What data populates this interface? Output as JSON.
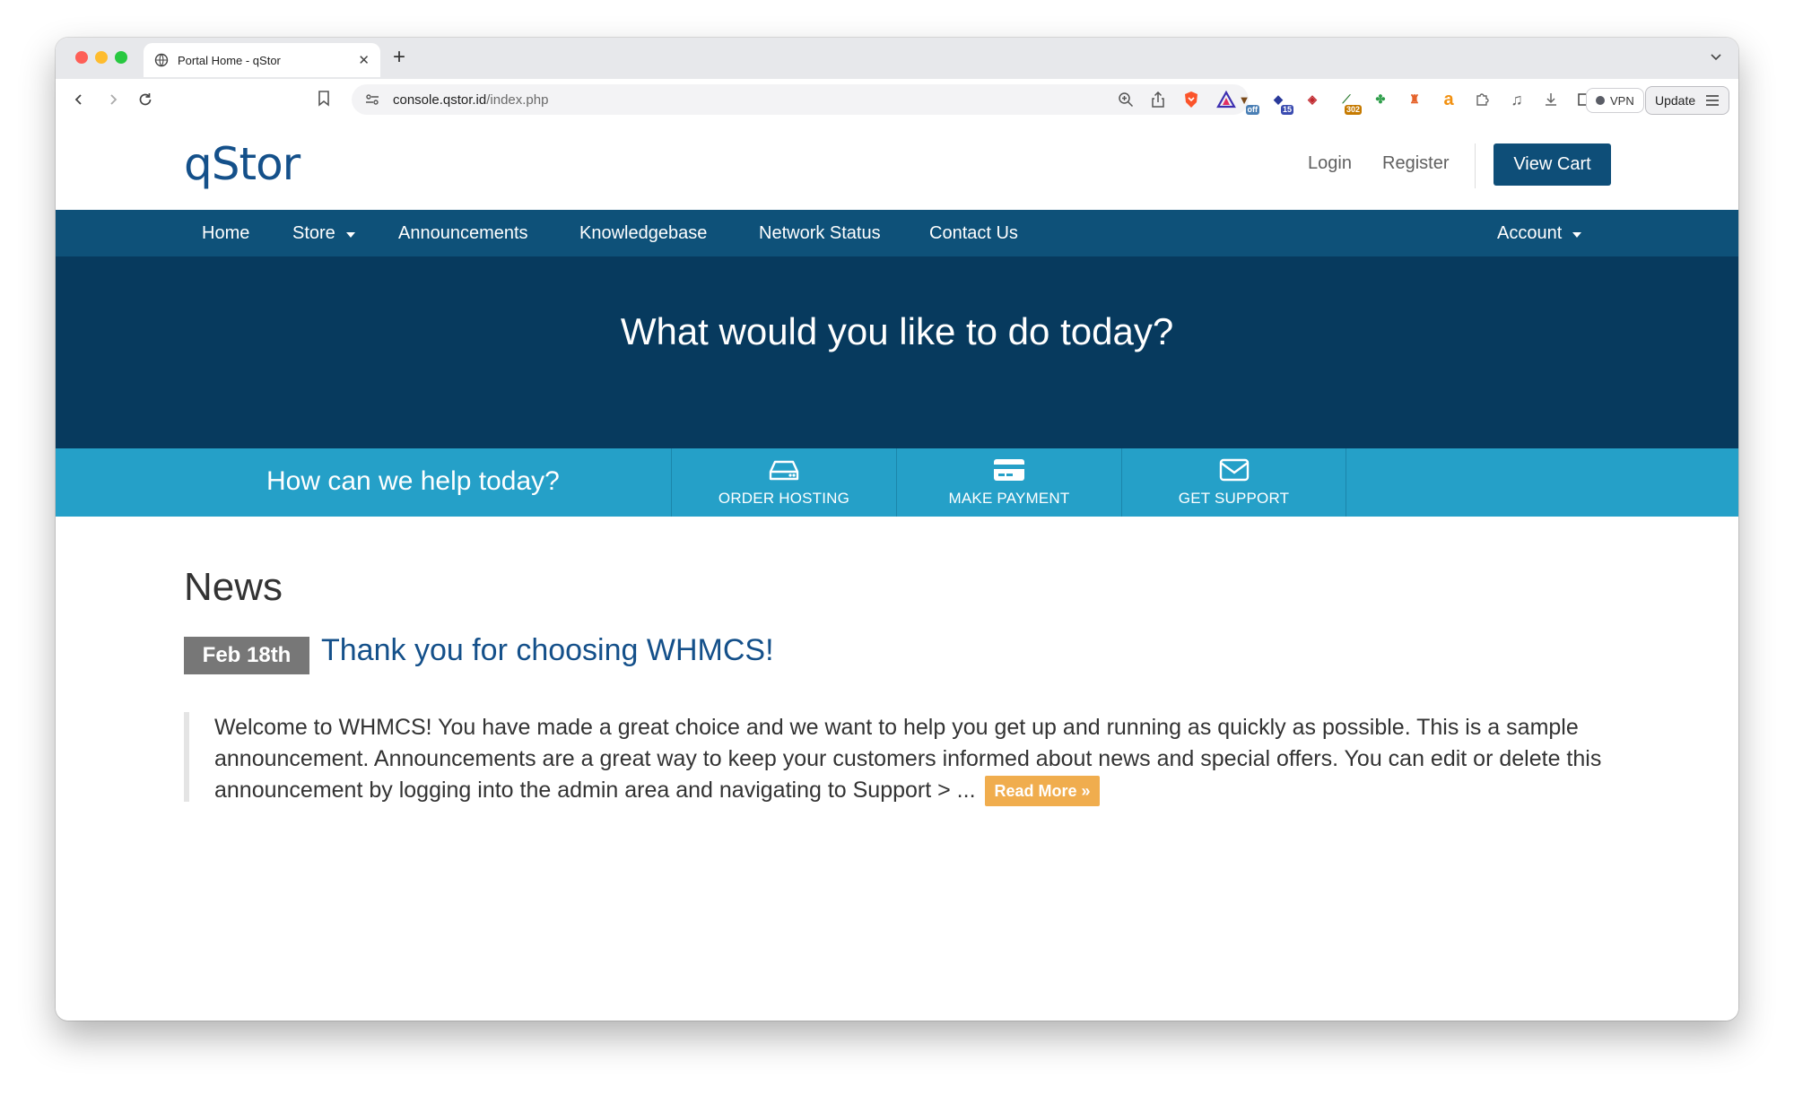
{
  "browser": {
    "tab_title": "Portal Home - qStor",
    "new_tab_symbol": "+",
    "url_host": "console.qstor.id",
    "url_path": "/index.php",
    "vpn_label": "VPN",
    "update_label": "Update",
    "extensions": [
      {
        "name": "off-extension-icon",
        "badge": "off"
      },
      {
        "name": "graduation-extension-icon",
        "badge": "15"
      },
      {
        "name": "diamond-extension-icon",
        "badge": ""
      },
      {
        "name": "redirect-extension-icon",
        "badge": "302"
      },
      {
        "name": "clover-extension-icon",
        "badge": ""
      },
      {
        "name": "chess-extension-icon",
        "badge": ""
      },
      {
        "name": "amazon-extension-icon",
        "badge": ""
      },
      {
        "name": "puzzle-extension-icon",
        "badge": ""
      },
      {
        "name": "music-extension-icon",
        "badge": ""
      },
      {
        "name": "download-icon",
        "badge": ""
      },
      {
        "name": "sidebar-icon",
        "badge": ""
      }
    ]
  },
  "header": {
    "logo": "qStor",
    "login": "Login",
    "register": "Register",
    "view_cart": "View Cart"
  },
  "nav": {
    "home": "Home",
    "store": "Store",
    "announcements": "Announcements",
    "knowledgebase": "Knowledgebase",
    "network_status": "Network Status",
    "contact_us": "Contact Us",
    "account": "Account"
  },
  "hero": {
    "title": "What would you like to do today?"
  },
  "helpbar": {
    "text": "How can we help today?",
    "actions": [
      {
        "label": "ORDER HOSTING",
        "icon": "server-icon"
      },
      {
        "label": "MAKE PAYMENT",
        "icon": "credit-card-icon"
      },
      {
        "label": "GET SUPPORT",
        "icon": "envelope-icon"
      }
    ]
  },
  "news": {
    "heading": "News",
    "items": [
      {
        "date": "Feb 18th",
        "title": "Thank you for choosing WHMCS!",
        "body": "Welcome to WHMCS! You have made a great choice and we want to help you get up and running as quickly as possible. This is a sample announcement. Announcements are a great way to keep your customers informed about news and special offers. You can edit or delete this announcement by logging into the admin area and navigating to Support > ...",
        "read_more": "Read More »"
      }
    ]
  },
  "colors": {
    "brand_blue": "#14508a",
    "nav_bg": "#0e5179",
    "hero_bg": "#073a5e",
    "helpbar_bg": "#25a0c8",
    "read_more_bg": "#f0ad4e"
  }
}
